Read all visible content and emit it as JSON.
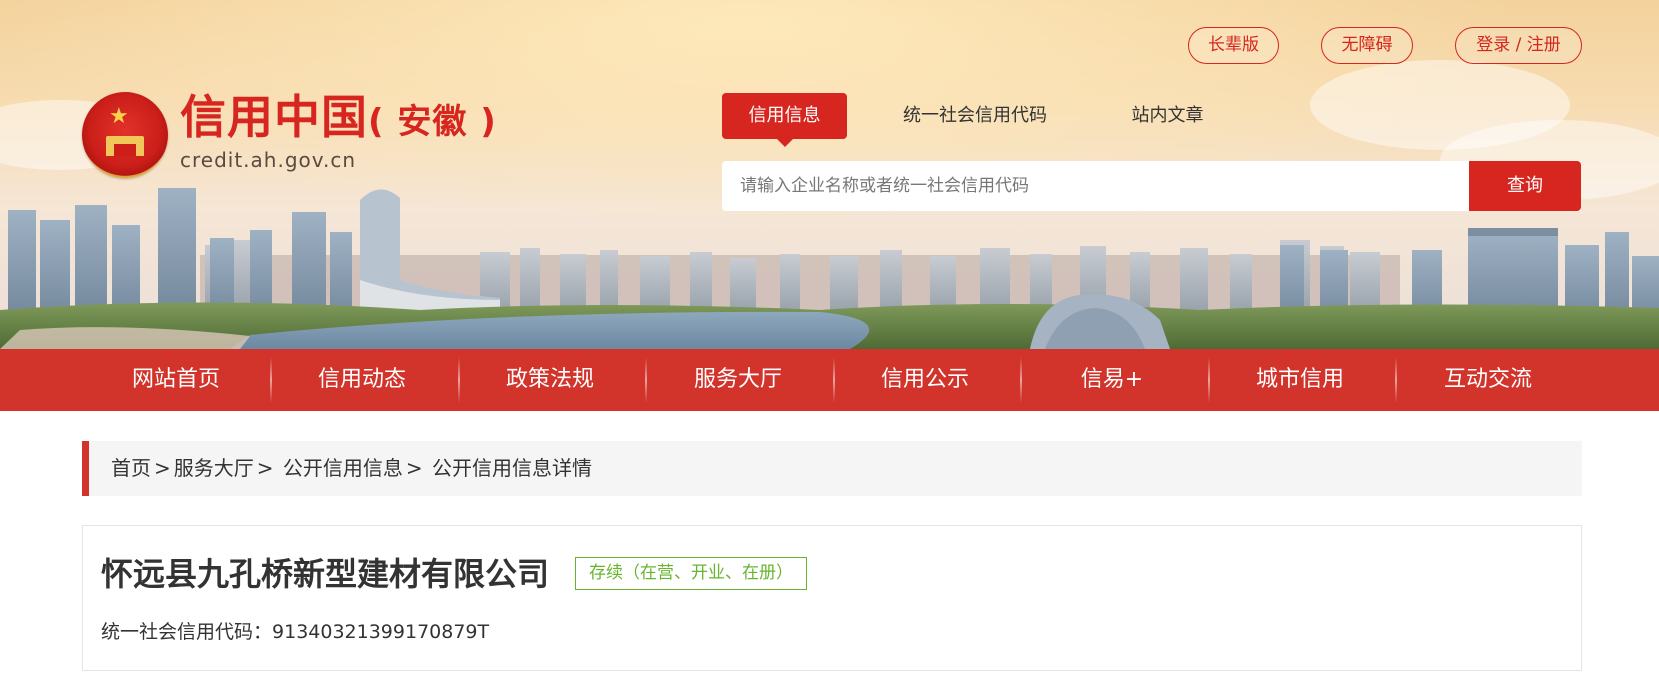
{
  "header": {
    "logo_title": "信用中国",
    "logo_region": "( 安徽 )",
    "logo_url": "credit.ah.gov.cn",
    "top_links": [
      "长辈版",
      "无障碍",
      "登录 / 注册"
    ]
  },
  "search": {
    "tabs": [
      "信用信息",
      "统一社会信用代码",
      "站内文章"
    ],
    "active_tab": "信用信息",
    "placeholder": "请输入企业名称或者统一社会信用代码",
    "button_label": "查询"
  },
  "nav": {
    "items": [
      "网站首页",
      "信用动态",
      "政策法规",
      "服务大厅",
      "信用公示",
      "信易+",
      "城市信用",
      "互动交流"
    ]
  },
  "breadcrumb": {
    "items": [
      "首页",
      "服务大厅",
      "公开信用信息",
      "公开信用信息详情"
    ],
    "separator": ">"
  },
  "company": {
    "name": "怀远县九孔桥新型建材有限公司",
    "status": "存续（在营、开业、在册）",
    "credit_code_label": "统一社会信用代码：",
    "credit_code": "91340321399170879T"
  },
  "colors": {
    "brand_red": "#d2332b",
    "status_green": "#67b52e"
  }
}
